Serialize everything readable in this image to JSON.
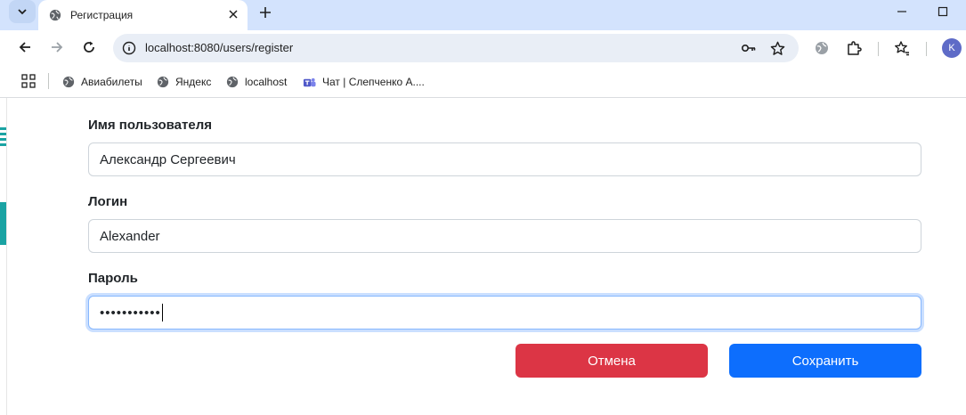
{
  "browser": {
    "tab": {
      "title": "Регистрация"
    },
    "url": "localhost:8080/users/register",
    "profile_initial": "K",
    "bookmarks": [
      {
        "label": "Авиабилеты"
      },
      {
        "label": "Яндекс"
      },
      {
        "label": "localhost"
      },
      {
        "label": "Чат | Слепченко А...."
      }
    ]
  },
  "form": {
    "username": {
      "label": "Имя пользователя",
      "value": "Александр Сергеевич"
    },
    "login": {
      "label": "Логин",
      "value": "Alexander"
    },
    "password": {
      "label": "Пароль",
      "value": "•••••••••••"
    },
    "cancel_label": "Отмена",
    "save_label": "Сохранить"
  },
  "colors": {
    "cancel": "#dc3545",
    "save": "#0d6efd",
    "tabstrip": "#d3e3fd"
  }
}
